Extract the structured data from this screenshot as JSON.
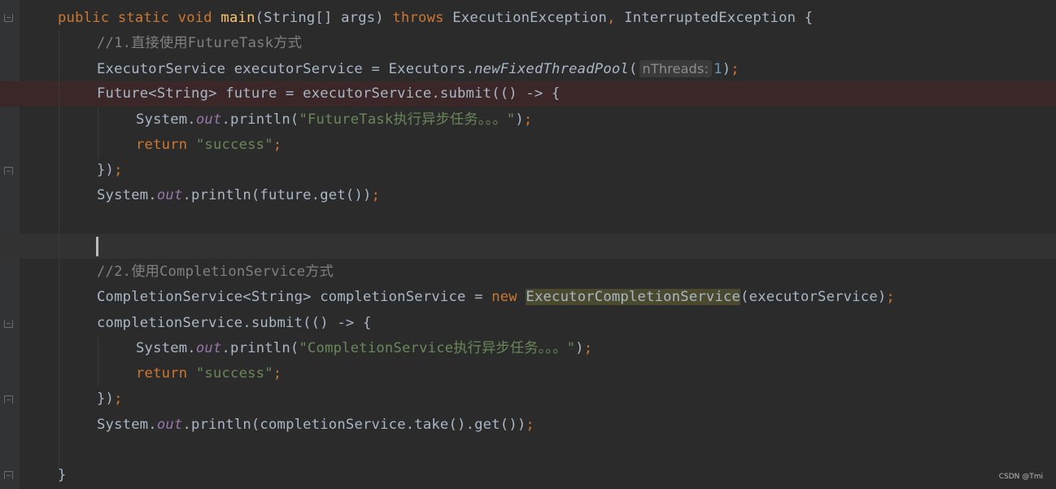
{
  "editor": {
    "lines": [
      {
        "tokens": [
          {
            "t": "public static void ",
            "c": "kw"
          },
          {
            "t": "main",
            "c": "fn"
          },
          {
            "t": "(String[] args) ",
            "c": ""
          },
          {
            "t": "throws ",
            "c": "kw"
          },
          {
            "t": "ExecutionException",
            "c": ""
          },
          {
            "t": ", ",
            "c": "kw"
          },
          {
            "t": "InterruptedException {",
            "c": ""
          }
        ]
      },
      {
        "tokens": [
          {
            "t": "//1.直接使用FutureTask方式",
            "c": "cm"
          }
        ]
      },
      {
        "tokens": [
          {
            "t": "ExecutorService executorService = Executors.",
            "c": ""
          },
          {
            "t": "newFixedThreadPool",
            "c": "it"
          },
          {
            "t": "(",
            "c": ""
          },
          {
            "t": "nThreads:",
            "c": "hint"
          },
          {
            "t": "1",
            "c": "hint-v"
          },
          {
            "t": ")",
            "c": ""
          },
          {
            "t": ";",
            "c": "kw"
          }
        ]
      },
      {
        "tokens": [
          {
            "t": "Future<String> future = executorService.submit(() -> {",
            "c": ""
          }
        ]
      },
      {
        "tokens": [
          {
            "t": "System.",
            "c": ""
          },
          {
            "t": "out",
            "c": "st-i"
          },
          {
            "t": ".println(",
            "c": ""
          },
          {
            "t": "\"FutureTask执行异步任务。。。\"",
            "c": "st"
          },
          {
            "t": ")",
            "c": ""
          },
          {
            "t": ";",
            "c": "kw"
          }
        ]
      },
      {
        "tokens": [
          {
            "t": "return ",
            "c": "kw"
          },
          {
            "t": "\"success\"",
            "c": "st"
          },
          {
            "t": ";",
            "c": "kw"
          }
        ]
      },
      {
        "tokens": [
          {
            "t": "})",
            "c": ""
          },
          {
            "t": ";",
            "c": "kw"
          }
        ]
      },
      {
        "tokens": [
          {
            "t": "System.",
            "c": ""
          },
          {
            "t": "out",
            "c": "st-i"
          },
          {
            "t": ".println(future.get())",
            "c": ""
          },
          {
            "t": ";",
            "c": "kw"
          }
        ]
      },
      {
        "tokens": []
      },
      {
        "tokens": []
      },
      {
        "tokens": [
          {
            "t": "//2.使用CompletionService方式",
            "c": "cm"
          }
        ]
      },
      {
        "tokens": [
          {
            "t": "CompletionService<String> completionService = ",
            "c": ""
          },
          {
            "t": "new ",
            "c": "kw"
          },
          {
            "t": "ExecutorCompletionService",
            "c": "ident-hl"
          },
          {
            "t": "(executorService)",
            "c": ""
          },
          {
            "t": ";",
            "c": "kw"
          }
        ]
      },
      {
        "tokens": [
          {
            "t": "completionService.submit(() -> {",
            "c": ""
          }
        ]
      },
      {
        "tokens": [
          {
            "t": "System.",
            "c": ""
          },
          {
            "t": "out",
            "c": "st-i"
          },
          {
            "t": ".println(",
            "c": ""
          },
          {
            "t": "\"CompletionService执行异步任务。。。\"",
            "c": "st"
          },
          {
            "t": ")",
            "c": ""
          },
          {
            "t": ";",
            "c": "kw"
          }
        ]
      },
      {
        "tokens": [
          {
            "t": "return ",
            "c": "kw"
          },
          {
            "t": "\"success\"",
            "c": "st"
          },
          {
            "t": ";",
            "c": "kw"
          }
        ]
      },
      {
        "tokens": [
          {
            "t": "})",
            "c": ""
          },
          {
            "t": ";",
            "c": "kw"
          }
        ]
      },
      {
        "tokens": [
          {
            "t": "System.",
            "c": ""
          },
          {
            "t": "out",
            "c": "st-i"
          },
          {
            "t": ".println(completionService.take().get())",
            "c": ""
          },
          {
            "t": ";",
            "c": "kw"
          }
        ]
      },
      {
        "tokens": []
      },
      {
        "tokens": [
          {
            "t": "}",
            "c": ""
          }
        ]
      }
    ]
  },
  "watermark": "CSDN @Tmi",
  "colors": {
    "background": "#2b2b2b",
    "keyword": "#cc7832",
    "method": "#ffc66d",
    "comment": "#808080",
    "string": "#6a8759",
    "static_field": "#9876aa",
    "number": "#6897bb",
    "text": "#a9b7c6",
    "error_line": "#3b2727",
    "caret_line": "#323232"
  }
}
